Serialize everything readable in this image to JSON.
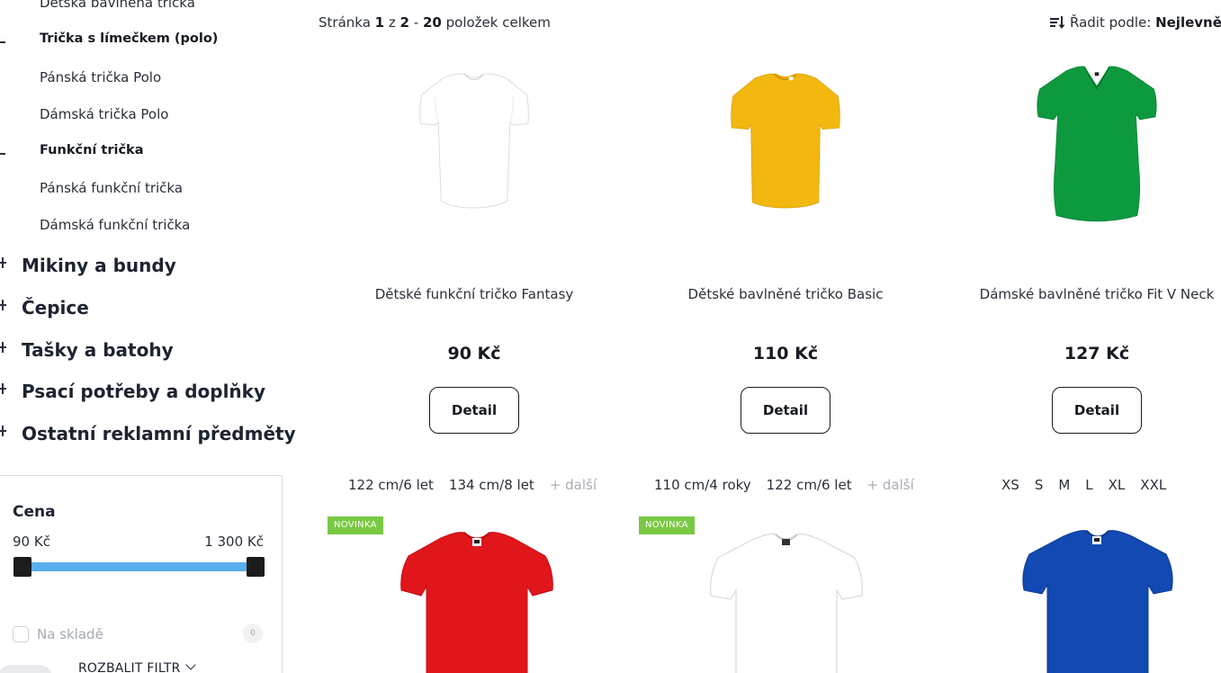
{
  "sidebar": {
    "sub_categories": [
      {
        "label": "Dětská bavlněná trička",
        "bold": false
      },
      {
        "label": "Trička s límečkem (polo)",
        "bold": true
      },
      {
        "label": "Pánská trička Polo",
        "bold": false
      },
      {
        "label": "Dámská trička Polo",
        "bold": false
      },
      {
        "label": "Funkční trička",
        "bold": true
      },
      {
        "label": "Pánská funkční trička",
        "bold": false
      },
      {
        "label": "Dámská funkční trička",
        "bold": false
      }
    ],
    "main_categories": [
      "Mikiny a bundy",
      "Čepice",
      "Tašky a batohy",
      "Psací potřeby a doplňky",
      "Ostatní reklamní předměty"
    ]
  },
  "filter": {
    "title": "Cena",
    "price_min": "90 Kč",
    "price_max": "1 300 Kč",
    "instock_label": "Na skladě",
    "instock_count": "0",
    "expand_label": "ROZBALIT FILTR"
  },
  "listing": {
    "page_prefix": "Stránka",
    "page_current": "1",
    "page_of": "z",
    "page_total": "2",
    "dash": "-",
    "item_count": "20",
    "items_suffix": "položek celkem",
    "sort_prefix": "Řadit podle:",
    "sort_value": "Nejlevnějš"
  },
  "products": [
    {
      "name": "Dětské funkční tričko Fantasy",
      "price": "90 Kč",
      "button": "Detail",
      "shirt_color": "#ffffff",
      "style": "crew"
    },
    {
      "name": "Dětské bavlněné tričko Basic",
      "price": "110 Kč",
      "button": "Detail",
      "shirt_color": "#f2b80f",
      "style": "crew"
    },
    {
      "name": "Dámské bavlněné tričko Fit V Neck",
      "price": "127 Kč",
      "button": "Detail",
      "shirt_color": "#0d9a3f",
      "style": "vneck"
    }
  ],
  "size_rows": [
    {
      "sizes": [
        "122 cm/6 let",
        "134 cm/8 let"
      ],
      "more": "+ další"
    },
    {
      "sizes": [
        "110 cm/4 roky",
        "122 cm/6 let"
      ],
      "more": "+ další"
    },
    {
      "sizes": [
        "XS",
        "S",
        "M",
        "L",
        "XL",
        "XXL"
      ],
      "more": ""
    }
  ],
  "second_row": [
    {
      "badge": "NOVINKA",
      "shirt_color": "#e0161b"
    },
    {
      "badge": "NOVINKA",
      "shirt_color": "#ffffff"
    },
    {
      "badge": "",
      "shirt_color": "#1249b3"
    }
  ]
}
